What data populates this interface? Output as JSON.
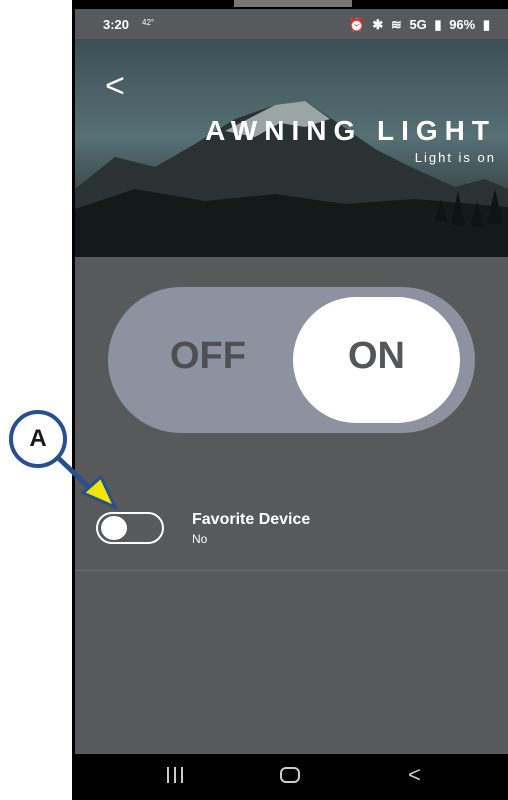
{
  "status_bar": {
    "time": "3:20",
    "temperature": "42°",
    "icons": [
      "alarm-icon",
      "bluetooth-icon",
      "wifi-icon",
      "5g-icon",
      "signal-icon"
    ],
    "network": "5G",
    "battery": "96%"
  },
  "header": {
    "back_symbol": "<",
    "title": "AWNING LIGHT",
    "subtitle": "Light is on"
  },
  "power_toggle": {
    "off_label": "OFF",
    "on_label": "ON",
    "state": "on"
  },
  "favorite": {
    "title": "Favorite Device",
    "value": "No",
    "enabled": false
  },
  "annotation": {
    "label": "A",
    "arrow_color": "#f2e600",
    "circle_border_color": "#26508f"
  },
  "nav_bar": {
    "back_symbol": "<"
  },
  "colors": {
    "screen_background": "#58595b",
    "toggle_track": "#8e919f",
    "toggle_knob": "#ffffff"
  }
}
